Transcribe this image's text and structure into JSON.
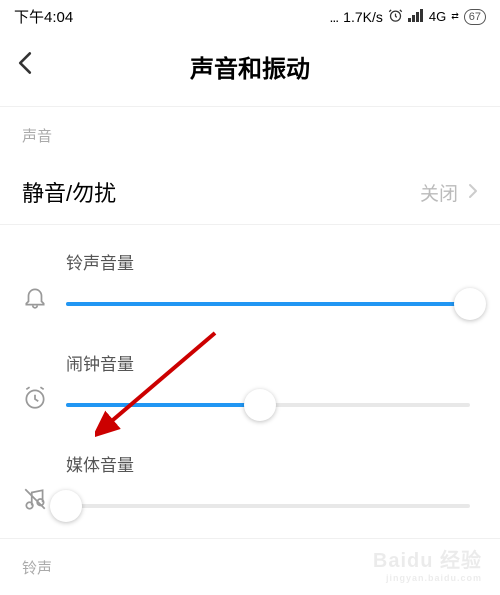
{
  "status": {
    "time": "下午4:04",
    "net_speed": "1.7K/s",
    "network": "4G",
    "battery": "67"
  },
  "header": {
    "title": "声音和振动"
  },
  "sections": {
    "sound_label": "声音",
    "ringtone_label": "铃声"
  },
  "silent_row": {
    "label": "静音/勿扰",
    "value": "关闭"
  },
  "sliders": {
    "ringtone": {
      "label": "铃声音量",
      "percent": 100
    },
    "alarm": {
      "label": "闹钟音量",
      "percent": 48
    },
    "media": {
      "label": "媒体音量",
      "percent": 0
    }
  },
  "colors": {
    "accent": "#2196f3"
  },
  "watermark": {
    "brand": "Baidu 经验",
    "url": "jingyan.baidu.com"
  }
}
